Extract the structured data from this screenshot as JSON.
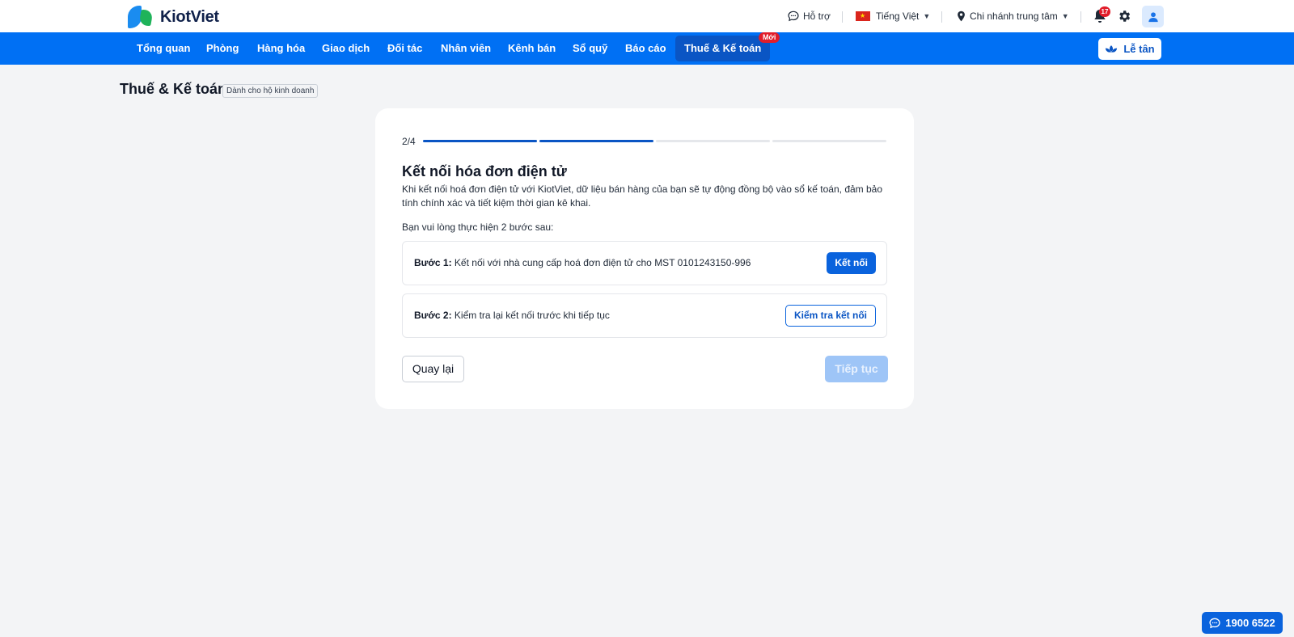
{
  "app": {
    "name": "KiotViet"
  },
  "topbar": {
    "support_label": "Hỗ trợ",
    "language_label": "Tiếng Việt",
    "branch_label": "Chi nhánh trung tâm",
    "notification_count": "17"
  },
  "nav": {
    "items": [
      {
        "label": "Tổng quan"
      },
      {
        "label": "Phòng"
      },
      {
        "label": "Hàng hóa"
      },
      {
        "label": "Giao dịch"
      },
      {
        "label": "Đối tác"
      },
      {
        "label": "Nhân viên"
      },
      {
        "label": "Kênh bán"
      },
      {
        "label": "Sổ quỹ"
      },
      {
        "label": "Báo cáo"
      },
      {
        "label": "Thuế & Kế toán",
        "badge": "Mới",
        "active": true
      }
    ],
    "reception_label": "Lễ tân"
  },
  "page": {
    "title": "Thuế & Kế toán",
    "tag": "Dành cho hộ kinh doanh"
  },
  "wizard": {
    "step_indicator": "2/4",
    "total_steps": 4,
    "completed_steps": 2,
    "title": "Kết nối hóa đơn điện tử",
    "description": "Khi kết nối hoá đơn điện tử với KiotViet, dữ liệu bán hàng của bạn sẽ tự động đồng bộ vào sổ kế toán, đảm bảo tính chính xác và tiết kiệm thời gian kê khai.",
    "instructions": "Bạn vui lòng thực hiện 2 bước sau:",
    "steps": [
      {
        "label": "Bước 1:",
        "text": "Kết nối với nhà cung cấp hoá đơn điện tử cho MST 0101243150-996",
        "action": "Kết nối"
      },
      {
        "label": "Bước 2:",
        "text": "Kiểm tra lại kết nối trước khi tiếp tục",
        "action": "Kiểm tra kết nối"
      }
    ],
    "back_label": "Quay lại",
    "next_label": "Tiếp tục"
  },
  "hotline": {
    "label": "1900 6522"
  },
  "colors": {
    "brand_blue": "#0070f4",
    "active_nav": "#0a55c4",
    "badge_red": "#e11d2a",
    "disabled_button": "#9ec5f7"
  }
}
